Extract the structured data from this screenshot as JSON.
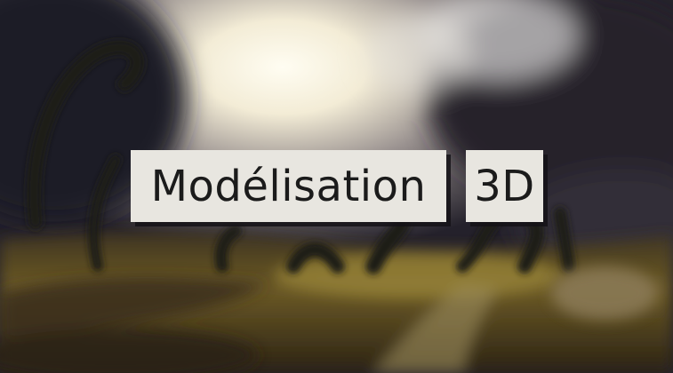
{
  "banner": {
    "word_1": "Modélisation",
    "word_2": "3D"
  },
  "scene": {
    "description_icon": "stormy-sky-landscape-background",
    "colors": {
      "sky_glow": "#fffbe8",
      "storm_cloud": "#2a2733",
      "field": "#6e5a24",
      "label_bg": "#e8e6e0",
      "label_text": "#1b1b1b"
    }
  }
}
